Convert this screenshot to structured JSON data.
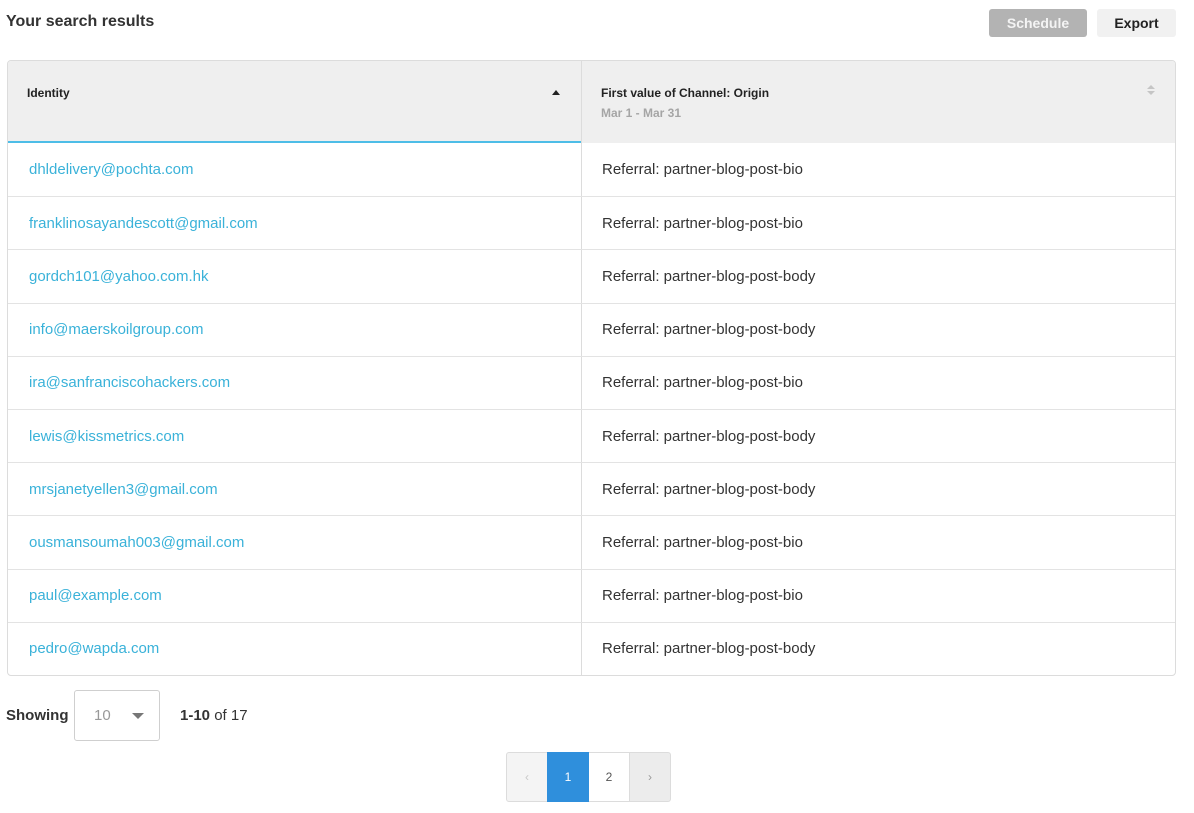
{
  "header": {
    "title": "Your search results",
    "schedule_label": "Schedule",
    "export_label": "Export"
  },
  "table": {
    "columns": [
      {
        "title": "Identity",
        "subtitle": ""
      },
      {
        "title": "First value of Channel: Origin",
        "subtitle": "Mar 1 - Mar 31"
      }
    ],
    "rows": [
      {
        "identity": "dhldelivery@pochta.com",
        "value": "Referral: partner-blog-post-bio"
      },
      {
        "identity": "franklinosayandescott@gmail.com",
        "value": "Referral: partner-blog-post-bio"
      },
      {
        "identity": "gordch101@yahoo.com.hk",
        "value": "Referral: partner-blog-post-body"
      },
      {
        "identity": "info@maerskoilgroup.com",
        "value": "Referral: partner-blog-post-body"
      },
      {
        "identity": "ira@sanfranciscohackers.com",
        "value": "Referral: partner-blog-post-bio"
      },
      {
        "identity": "lewis@kissmetrics.com",
        "value": "Referral: partner-blog-post-body"
      },
      {
        "identity": "mrsjanetyellen3@gmail.com",
        "value": "Referral: partner-blog-post-body"
      },
      {
        "identity": "ousmansoumah003@gmail.com",
        "value": "Referral: partner-blog-post-bio"
      },
      {
        "identity": "paul@example.com",
        "value": "Referral: partner-blog-post-bio"
      },
      {
        "identity": "pedro@wapda.com",
        "value": "Referral: partner-blog-post-body"
      }
    ]
  },
  "footer": {
    "showing_label": "Showing",
    "per_page_value": "10",
    "range": "1-10",
    "of_text": " of 17"
  },
  "pagination": {
    "prev_symbol": "‹",
    "pages": [
      "1",
      "2"
    ],
    "active_page": "1",
    "next_symbol": "›"
  },
  "colors": {
    "link": "#3ab2d9",
    "active_page": "#2f8fdc",
    "schedule_disabled": "#b3b3b3",
    "sorted_column_underline": "#4dbde7"
  },
  "icons": {
    "identity_sort": "sort-ascending-icon",
    "channel_sort": "sort-unsorted-icon",
    "per_page_caret": "chevron-down-icon"
  }
}
